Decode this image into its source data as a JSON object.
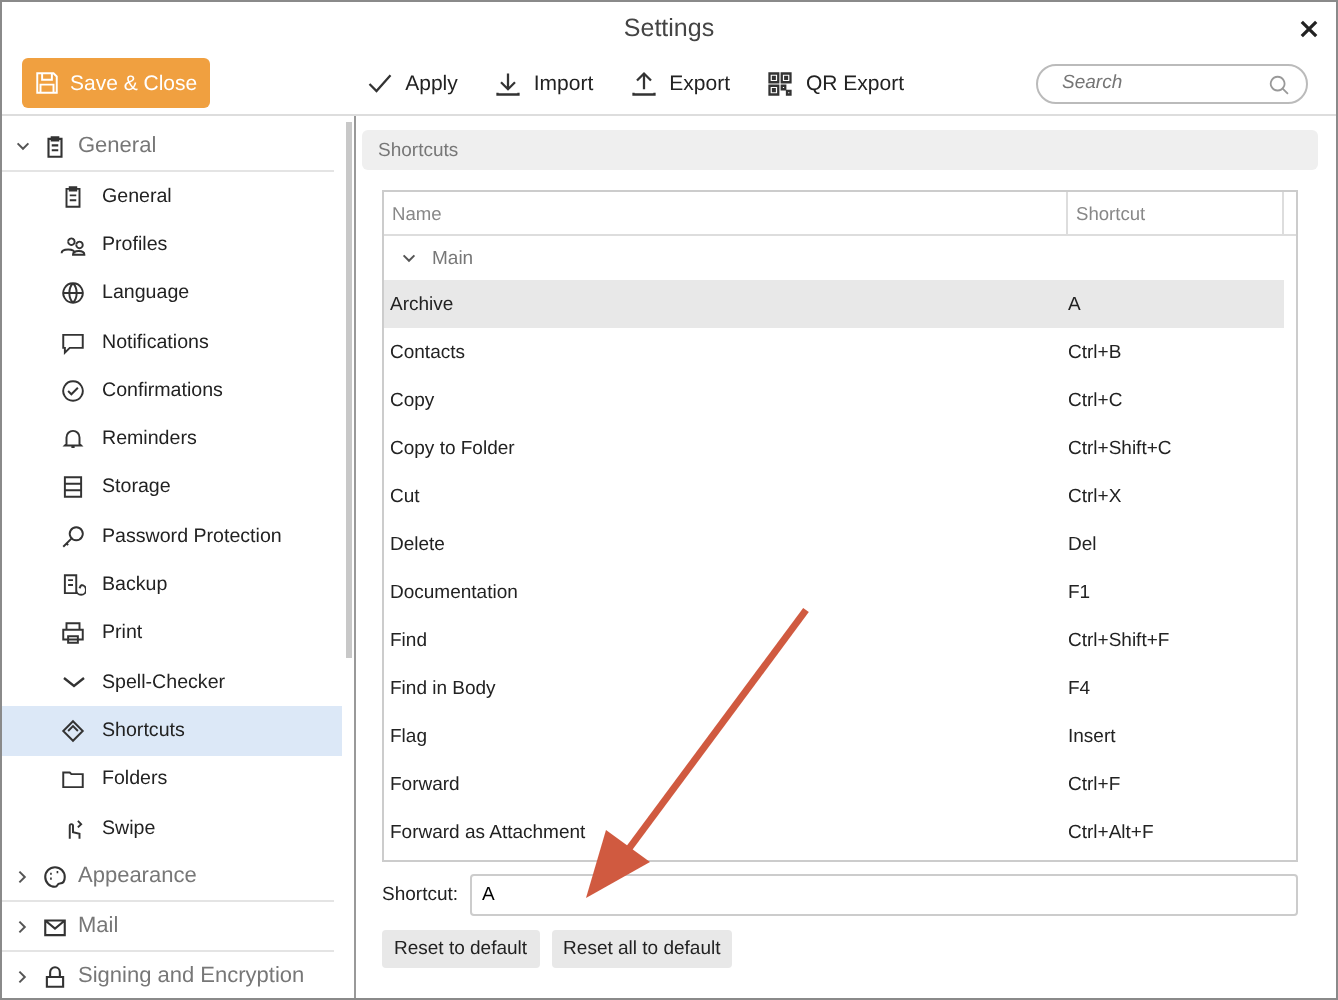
{
  "window": {
    "title": "Settings"
  },
  "toolbar": {
    "save_button": "Save & Close",
    "actions": [
      {
        "label": "Apply"
      },
      {
        "label": "Import"
      },
      {
        "label": "Export"
      },
      {
        "label": "QR Export"
      }
    ],
    "search": {
      "placeholder": "Search"
    }
  },
  "sidebar": {
    "groups": [
      {
        "label": "General",
        "expanded": true,
        "children": [
          {
            "label": "General",
            "selected": false
          },
          {
            "label": "Profiles",
            "selected": false
          },
          {
            "label": "Language",
            "selected": false
          },
          {
            "label": "Notifications",
            "selected": false
          },
          {
            "label": "Confirmations",
            "selected": false
          },
          {
            "label": "Reminders",
            "selected": false
          },
          {
            "label": "Storage",
            "selected": false
          },
          {
            "label": "Password Protection",
            "selected": false
          },
          {
            "label": "Backup",
            "selected": false
          },
          {
            "label": "Print",
            "selected": false
          },
          {
            "label": "Spell-Checker",
            "selected": false
          },
          {
            "label": "Shortcuts",
            "selected": true
          },
          {
            "label": "Folders",
            "selected": false
          },
          {
            "label": "Swipe",
            "selected": false
          }
        ]
      },
      {
        "label": "Appearance",
        "expanded": false
      },
      {
        "label": "Mail",
        "expanded": false
      },
      {
        "label": "Signing and Encryption",
        "expanded": false
      }
    ]
  },
  "panel": {
    "title": "Shortcuts",
    "table": {
      "columns": [
        "Name",
        "Shortcut"
      ],
      "group": {
        "label": "Main",
        "expanded": true
      },
      "rows": [
        {
          "name": "Archive",
          "shortcut": "A",
          "selected": true
        },
        {
          "name": "Contacts",
          "shortcut": "Ctrl+B",
          "selected": false
        },
        {
          "name": "Copy",
          "shortcut": "Ctrl+C",
          "selected": false
        },
        {
          "name": "Copy to Folder",
          "shortcut": "Ctrl+Shift+C",
          "selected": false
        },
        {
          "name": "Cut",
          "shortcut": "Ctrl+X",
          "selected": false
        },
        {
          "name": "Delete",
          "shortcut": "Del",
          "selected": false
        },
        {
          "name": "Documentation",
          "shortcut": "F1",
          "selected": false
        },
        {
          "name": "Find",
          "shortcut": "Ctrl+Shift+F",
          "selected": false
        },
        {
          "name": "Find in Body",
          "shortcut": "F4",
          "selected": false
        },
        {
          "name": "Flag",
          "shortcut": "Insert",
          "selected": false
        },
        {
          "name": "Forward",
          "shortcut": "Ctrl+F",
          "selected": false
        },
        {
          "name": "Forward as Attachment",
          "shortcut": "Ctrl+Alt+F",
          "selected": false
        }
      ]
    },
    "shortcut_field": {
      "label": "Shortcut:",
      "value": "A"
    },
    "buttons": [
      "Reset to default",
      "Reset all to default"
    ]
  }
}
